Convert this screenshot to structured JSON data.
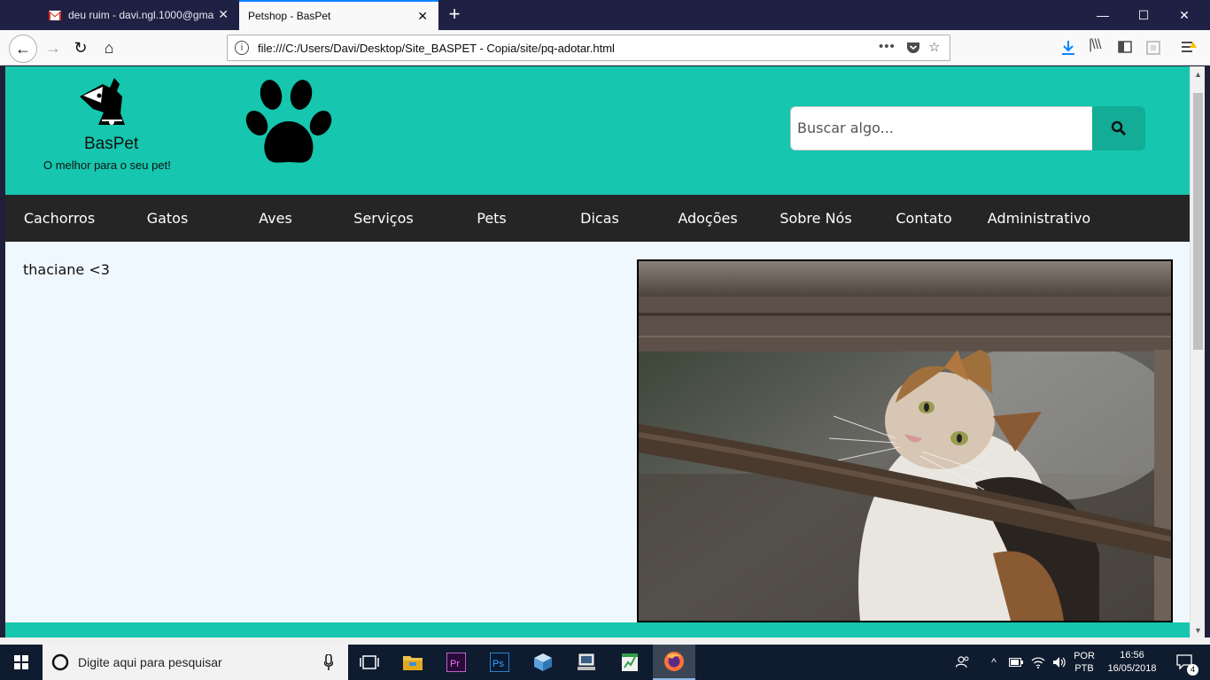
{
  "browser": {
    "tabs": [
      {
        "title": "deu ruim - davi.ngl.1000@gma",
        "favicon": "gmail-icon",
        "active": false
      },
      {
        "title": "Petshop - BasPet",
        "favicon": "none",
        "active": true
      }
    ],
    "url": "file:///C:/Users/Davi/Desktop/Site_BASPET - Copia/site/pq-adotar.html"
  },
  "site": {
    "brand_name": "BasPet",
    "slogan": "O melhor para o seu pet!",
    "search_placeholder": "Buscar algo...",
    "nav": [
      "Cachorros",
      "Gatos",
      "Aves",
      "Serviços",
      "Pets",
      "Dicas",
      "Adoções",
      "Sobre Nós",
      "Contato",
      "Administrativo"
    ],
    "content_text": "thaciane <3",
    "colors": {
      "header": "#16c6ae",
      "nav": "#252525",
      "search_button": "#13ad97",
      "background": "#f0f8ff"
    }
  },
  "taskbar": {
    "search_text": "Digite aqui para pesquisar",
    "language": "POR",
    "keyboard": "PTB",
    "time": "16:56",
    "date": "16/05/2018",
    "notifications": "4",
    "apps": [
      "task-view-icon",
      "file-explorer-icon",
      "premiere-icon",
      "photoshop-icon",
      "cube-app-icon",
      "computer-icon",
      "spreadsheet-icon",
      "firefox-icon"
    ]
  }
}
